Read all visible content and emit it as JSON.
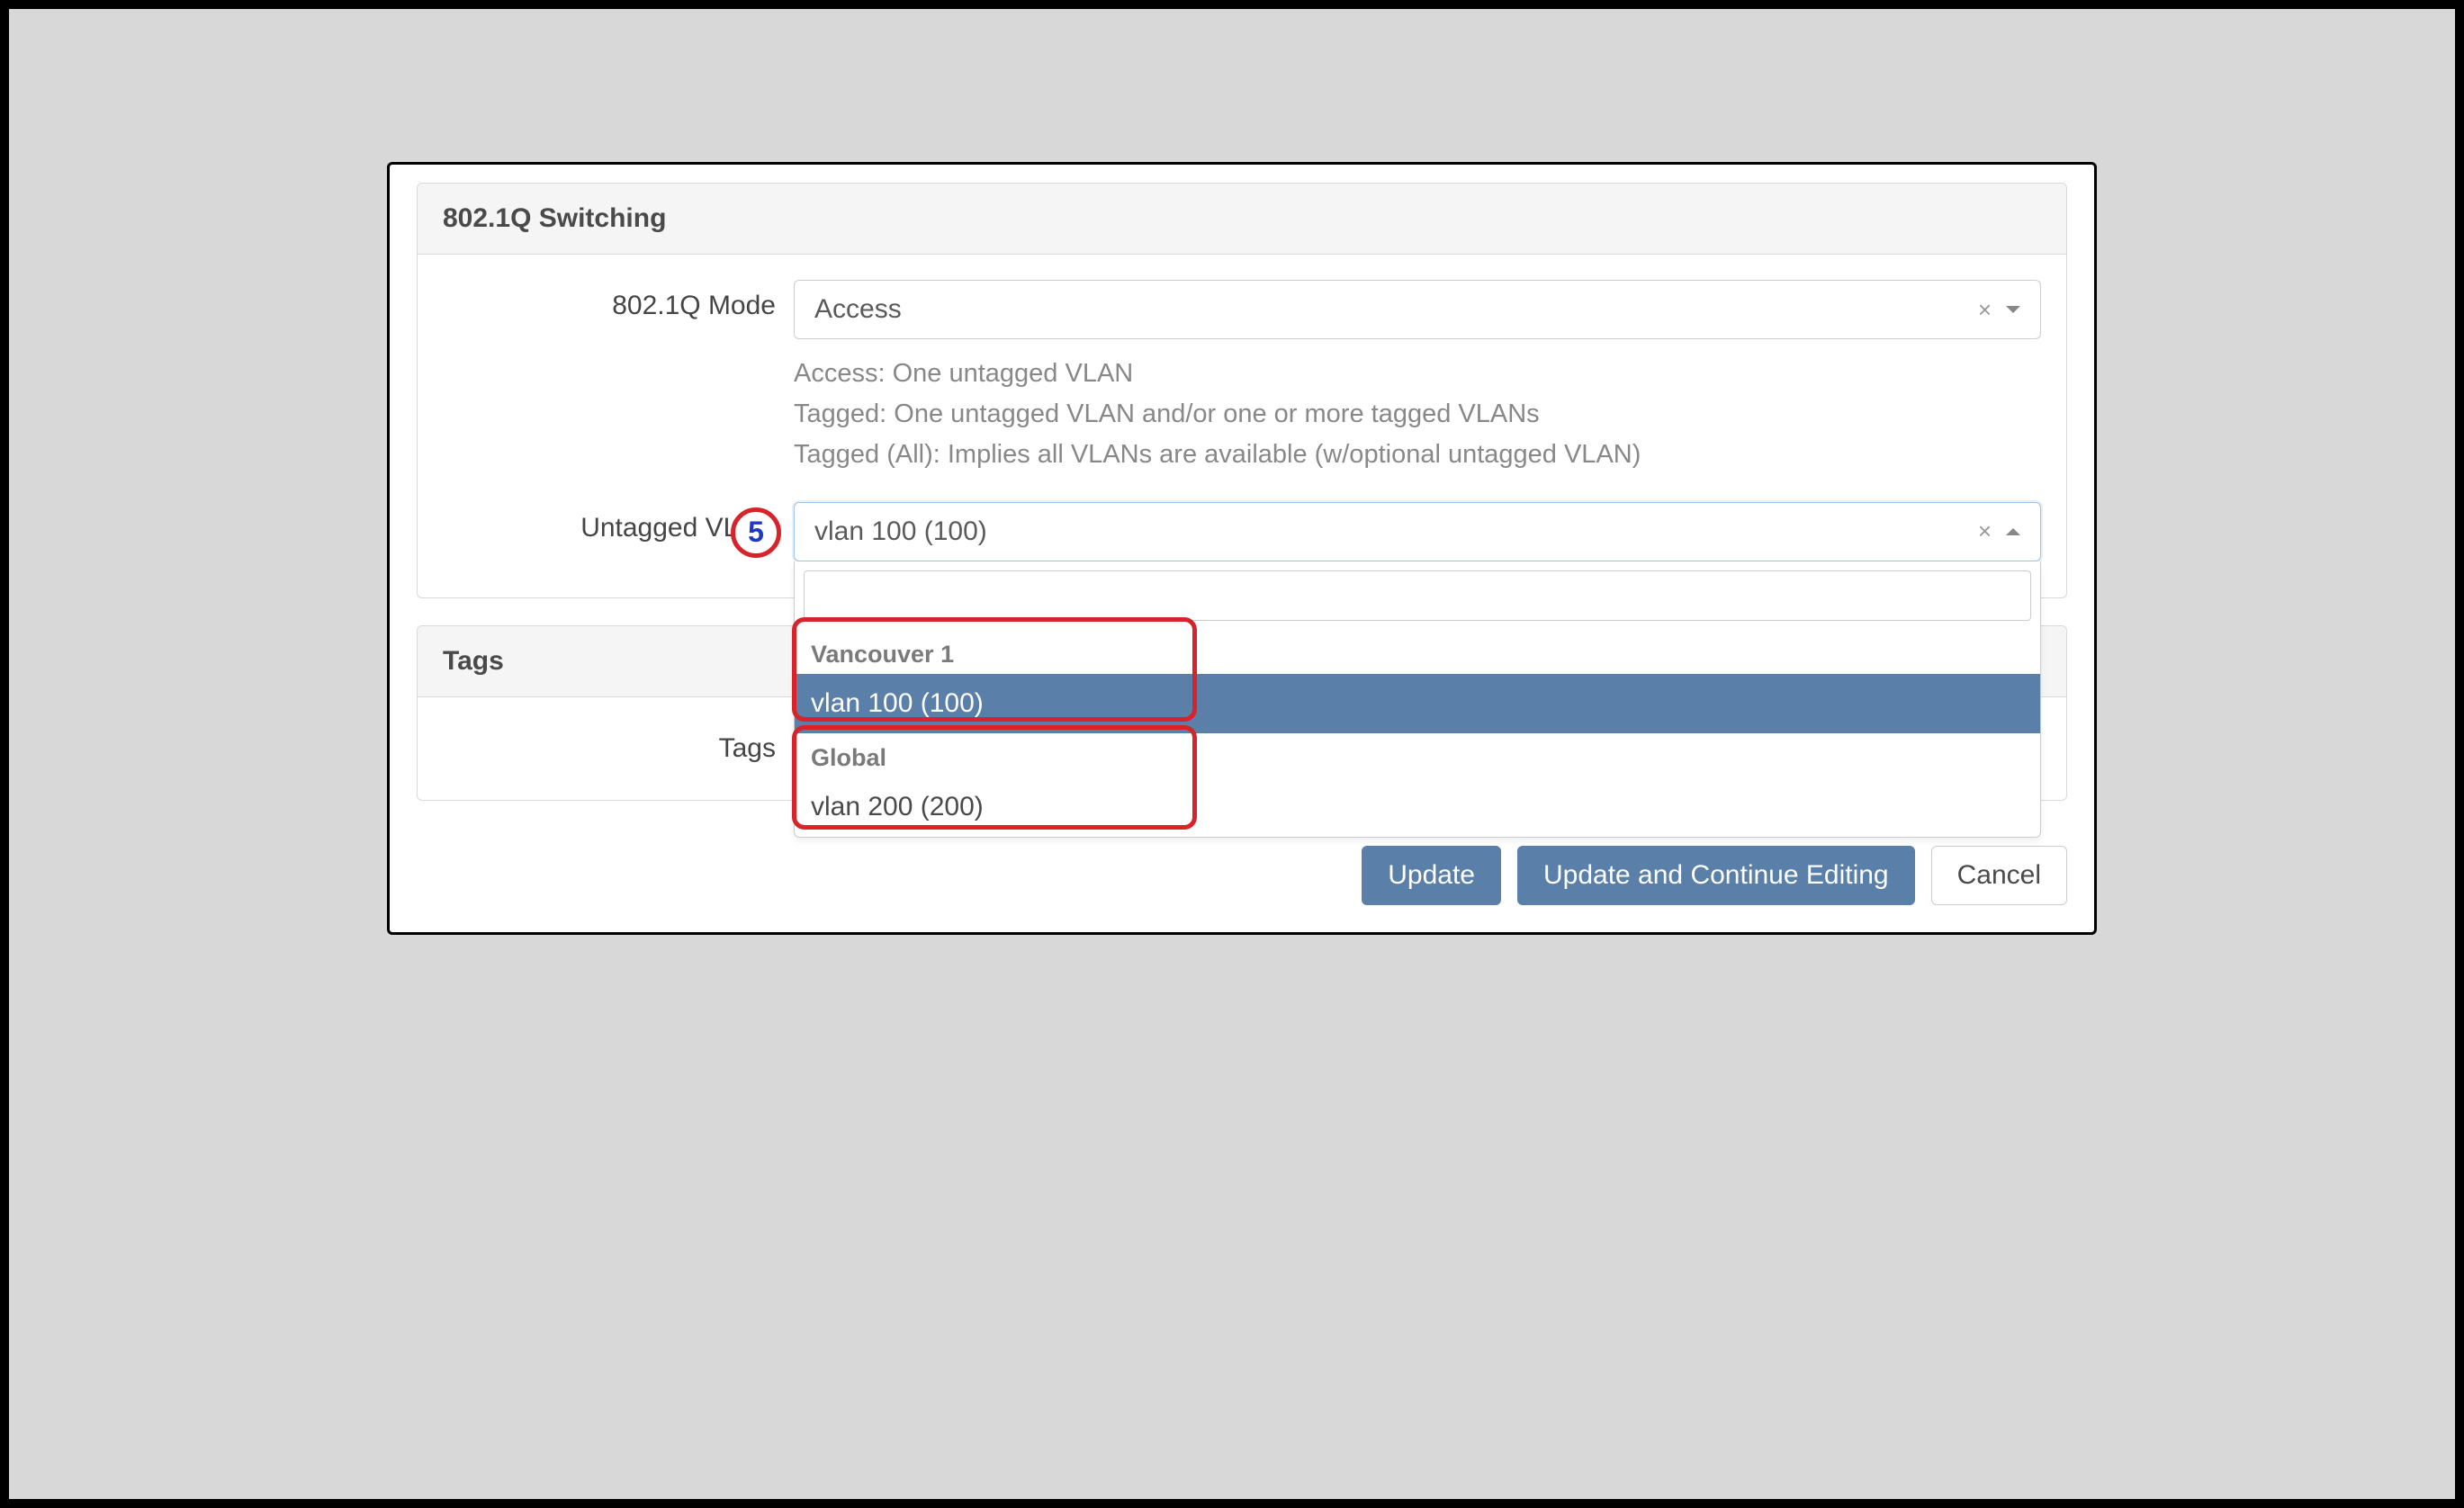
{
  "sections": {
    "switching": {
      "title": "802.1Q Switching",
      "mode": {
        "label": "802.1Q Mode",
        "value": "Access",
        "help1": "Access: One untagged VLAN",
        "help2": "Tagged: One untagged VLAN and/or one or more tagged VLANs",
        "help3": "Tagged (All): Implies all VLANs are available (w/optional untagged VLAN)"
      },
      "untagged_vlan": {
        "label": "Untagged VLAN",
        "value": "vlan 100 (100)",
        "groups": [
          {
            "name": "Vancouver 1",
            "options": [
              "vlan 100 (100)"
            ]
          },
          {
            "name": "Global",
            "options": [
              "vlan 200 (200)"
            ]
          }
        ]
      }
    },
    "tags": {
      "title": "Tags",
      "label": "Tags"
    }
  },
  "buttons": {
    "update": "Update",
    "update_continue": "Update and Continue Editing",
    "cancel": "Cancel"
  },
  "annotation": {
    "step": "5"
  }
}
